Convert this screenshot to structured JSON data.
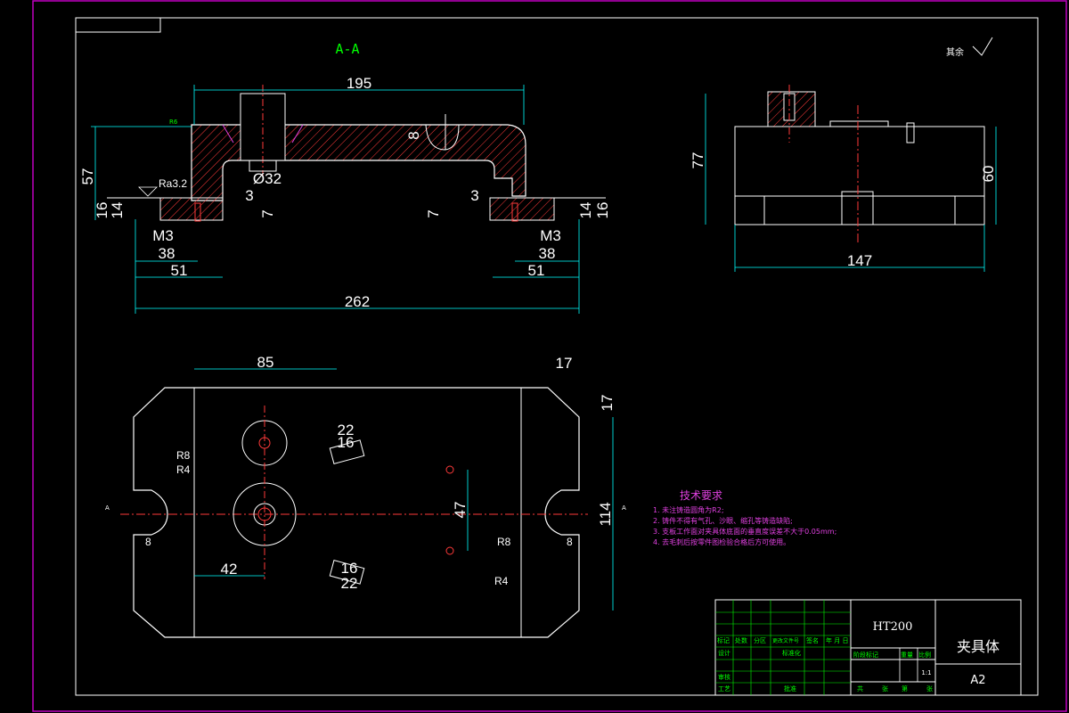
{
  "drawing": {
    "section_title": "A-A",
    "surface_finish_note": "其余",
    "section_marks": [
      "A",
      "A"
    ]
  },
  "section_view": {
    "dims": {
      "overall_width": "195",
      "total_length": "262",
      "height": "57",
      "bore": "Ø32",
      "roughness": "Ra3.2",
      "radius": "R6",
      "depth_8": "8",
      "left_16": "16",
      "left_14": "14",
      "right_14": "14",
      "right_16": "16",
      "left_3": "3",
      "right_3": "3",
      "left_7": "7",
      "right_7": "7",
      "left_thread": "M3",
      "right_thread": "M3",
      "left_38": "38",
      "right_38": "38",
      "left_51": "51",
      "right_51": "51"
    }
  },
  "side_view": {
    "dims": {
      "height_77": "77",
      "height_60": "60",
      "width_147": "147"
    }
  },
  "top_view": {
    "dims": {
      "d85": "85",
      "d17_top": "17",
      "d17_side": "17",
      "d114": "114",
      "d47": "47",
      "d42": "42",
      "d22_top": "22",
      "d16_top": "16",
      "d16_bottom": "16",
      "d22_bottom": "22",
      "r8_left": "R8",
      "r4_left": "R4",
      "r8_right": "R8",
      "r4_right": "R4",
      "d8_left": "8",
      "d8_right": "8"
    }
  },
  "technical_requirements": {
    "heading": "技术要求",
    "items": [
      "1. 未注铸造圆角为R2;",
      "2. 铸件不得有气孔、沙眼、缩孔等铸造缺陷;",
      "3. 支板工作面对夹具体底面的垂直度误差不大于0.05mm;",
      "4. 去毛刺后按零件图检验合格后方可使用。"
    ]
  },
  "title_block": {
    "material": "HT200",
    "part_name": "夹具体",
    "sheet_size": "A2",
    "scale": "1:1",
    "row_labels": [
      "标记",
      "处数",
      "分区",
      "更改文件号",
      "签名",
      "年 月 日"
    ],
    "roles": [
      "设计",
      "审核",
      "工艺"
    ],
    "mid_labels": [
      "标准化",
      "批准"
    ],
    "stage_labels": [
      "阶段标记",
      "重量",
      "比例"
    ],
    "sheet_labels": [
      "共",
      "张",
      "第",
      "张"
    ]
  }
}
